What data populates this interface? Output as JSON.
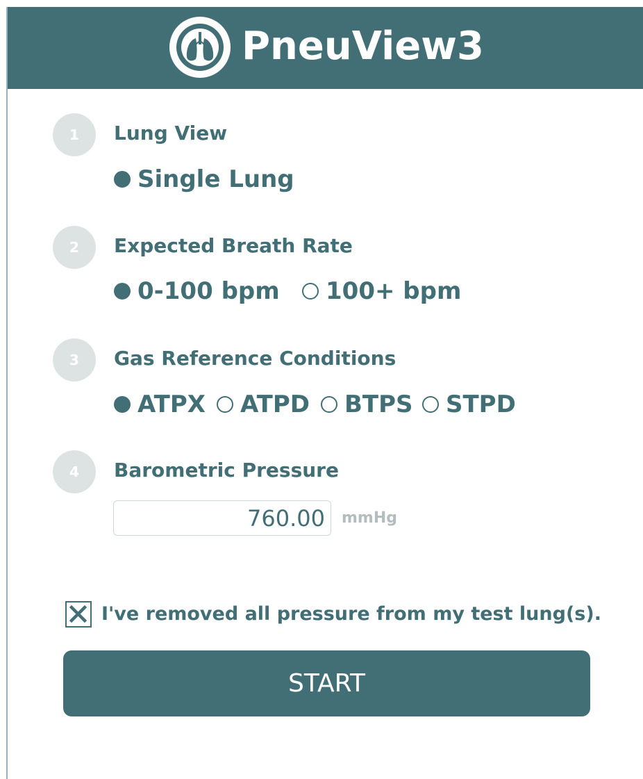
{
  "header": {
    "title": "PneuView3",
    "logo_icon": "lungs-icon"
  },
  "steps": [
    {
      "number": "1",
      "title": "Lung View",
      "options": [
        {
          "label": "Single Lung",
          "selected": true
        }
      ]
    },
    {
      "number": "2",
      "title": "Expected Breath Rate",
      "options": [
        {
          "label": "0-100 bpm",
          "selected": true
        },
        {
          "label": "100+ bpm",
          "selected": false
        }
      ]
    },
    {
      "number": "3",
      "title": "Gas Reference Conditions",
      "options": [
        {
          "label": "ATPX",
          "selected": true
        },
        {
          "label": "ATPD",
          "selected": false
        },
        {
          "label": "BTPS",
          "selected": false
        },
        {
          "label": "STPD",
          "selected": false
        }
      ]
    },
    {
      "number": "4",
      "title": "Barometric Pressure",
      "input_value": "760.00",
      "unit": "mmHg"
    }
  ],
  "confirmation": {
    "checked": true,
    "label": "I've removed all pressure from my test lung(s)."
  },
  "start_button": {
    "label": "START"
  },
  "colors": {
    "brand": "#426e75",
    "step_circle": "#dde3e3",
    "unit_text": "#b3bcbe"
  }
}
